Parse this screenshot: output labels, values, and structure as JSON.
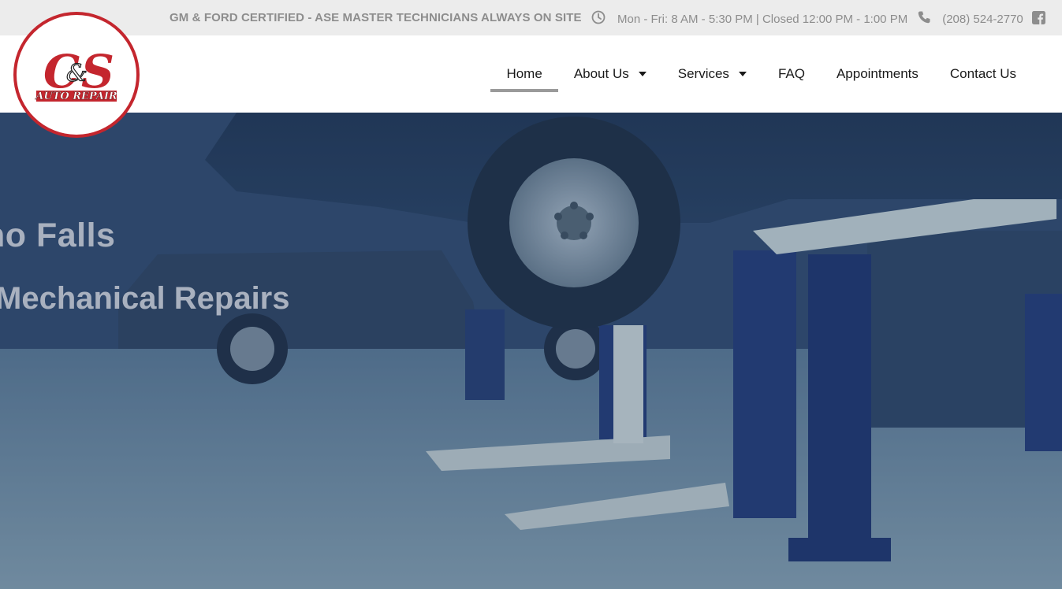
{
  "topbar": {
    "certification": "GM & FORD CERTIFIED - ASE MASTER TECHNICIANS ALWAYS ON SITE",
    "hours": "Mon - Fri: 8 AM - 5:30 PM | Closed 12:00 PM - 1:00 PM",
    "phone": "(208) 524-2770",
    "clock_icon": "clock-icon",
    "phone_icon": "phone-icon",
    "social_icon": "facebook-icon"
  },
  "logo": {
    "monogram": "C&S",
    "tagline": "AUTO REPAIR",
    "ring_color": "#c4262e"
  },
  "nav": {
    "items": [
      {
        "label": "Home",
        "active": true
      },
      {
        "label": "About Us",
        "dropdown": true
      },
      {
        "label": "Services",
        "dropdown": true
      },
      {
        "label": "FAQ"
      },
      {
        "label": "Appointments"
      },
      {
        "label": "Contact Us"
      }
    ]
  },
  "hero": {
    "title_visible": "ho Falls",
    "subtitle_visible": "Mechanical Repairs"
  },
  "colors": {
    "topbar_bg": "#ececec",
    "topbar_text": "#8d8d8d",
    "brand_red": "#c4262e",
    "nav_active_underline": "#9a9a9a"
  }
}
